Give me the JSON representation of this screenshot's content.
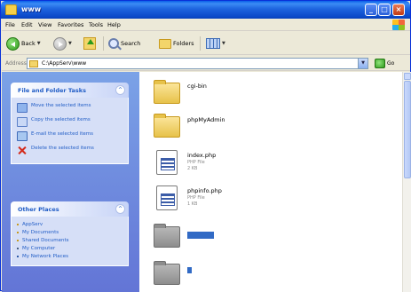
{
  "window": {
    "title": "www"
  },
  "menu": [
    "File",
    "Edit",
    "View",
    "Favorites",
    "Tools",
    "Help"
  ],
  "toolbar": {
    "back": "Back",
    "search": "Search",
    "folders": "Folders"
  },
  "address": {
    "label": "Address",
    "path": "C:\\AppServ\\www",
    "go": "Go"
  },
  "file_tasks": {
    "title": "File and Folder Tasks",
    "items": [
      "Move the selected items",
      "Copy the selected items",
      "E-mail the selected items",
      "Delete the selected items"
    ]
  },
  "other_places": {
    "title": "Other Places",
    "items": [
      "AppServ",
      "My Documents",
      "Shared Documents",
      "My Computer",
      "My Network Places"
    ]
  },
  "files": [
    {
      "name": "cgi-bin",
      "type": "folder"
    },
    {
      "name": "phpMyAdmin",
      "type": "folder"
    },
    {
      "name": "index.php",
      "type": "php",
      "kind": "PHP File",
      "size": "2 KB"
    },
    {
      "name": "phpinfo.php",
      "type": "php",
      "kind": "PHP File",
      "size": "1 KB"
    },
    {
      "name": "",
      "type": "folder-selected"
    },
    {
      "name": "",
      "type": "folder-gray"
    }
  ]
}
